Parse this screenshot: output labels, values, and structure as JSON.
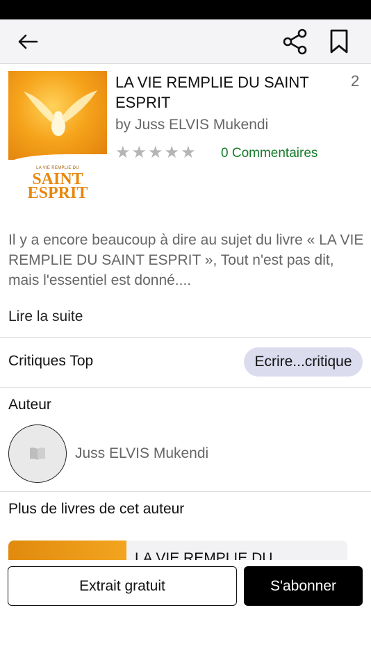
{
  "book": {
    "title": "LA VIE REMPLIE DU SAINT ESPRIT",
    "count": "2",
    "author_line": "by Juss ELVIS Mukendi",
    "rating_stars": 0,
    "comments_label": "0 Commentaires",
    "cover_small_text": "LA VIE REMPLIE DU",
    "cover_big_text": "SAINT ESPRIT"
  },
  "description": "Il y a encore beaucoup à dire au sujet du livre « LA VIE REMPLIE DU SAINT ESPRIT », Tout n'est pas dit, mais l'essentiel est donné....",
  "read_more_label": "Lire la suite",
  "reviews": {
    "title": "Critiques Top",
    "write_button": "Ecrire...critique"
  },
  "author_section": {
    "heading": "Auteur",
    "name": "Juss ELVIS Mukendi"
  },
  "more_books": {
    "heading": "Plus de livres de cet auteur",
    "items": [
      {
        "title": "LA VIE REMPLIE DU"
      }
    ]
  },
  "actions": {
    "excerpt_label": "Extrait gratuit",
    "subscribe_label": "S'abonner"
  },
  "icons": {
    "back": "back-arrow-icon",
    "share": "share-icon",
    "bookmark": "bookmark-icon",
    "author_placeholder": "book-icon",
    "star": "star-icon"
  },
  "colors": {
    "accent_green": "#147a28",
    "review_button_bg": "#dcdcef",
    "subscribe_bg": "#000000",
    "cover_orange": "#f6a41c"
  }
}
